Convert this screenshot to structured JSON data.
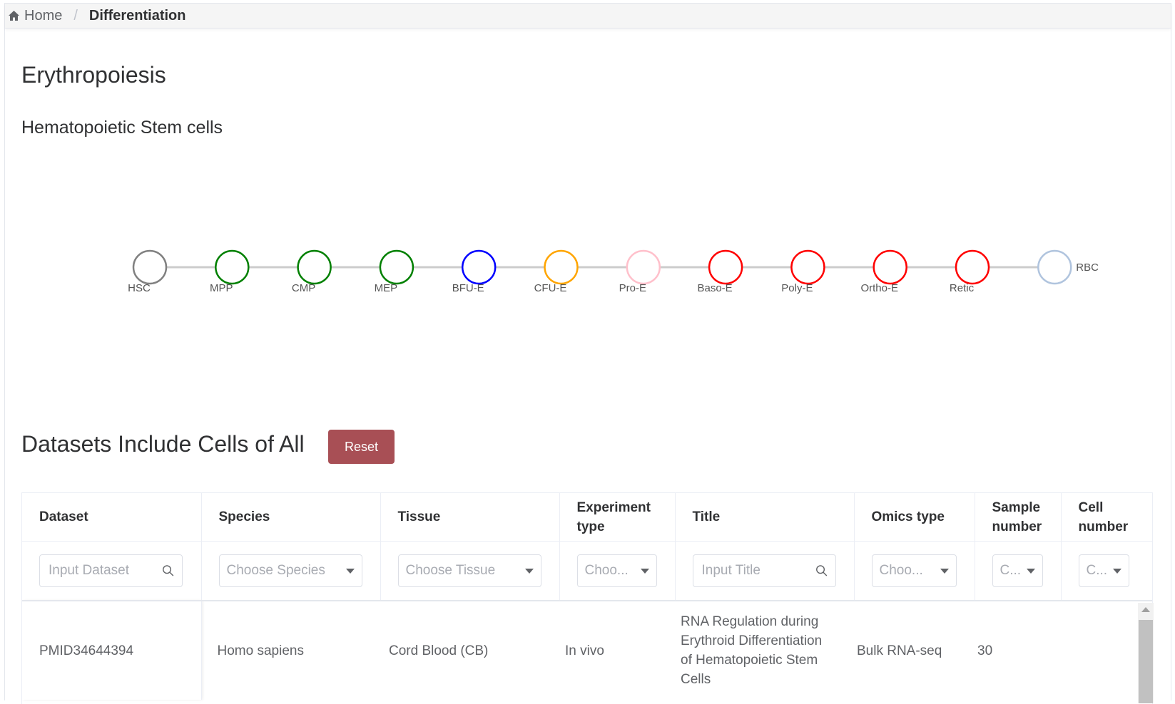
{
  "breadcrumb": {
    "home": "Home",
    "separator": "/",
    "current": "Differentiation"
  },
  "page_title": "Erythropoiesis",
  "sub_title": "Hematopoietic Stem cells",
  "lineage": {
    "line_color": "#cccccc",
    "nodes": [
      {
        "label": "HSC",
        "color": "#808080"
      },
      {
        "label": "MPP",
        "color": "#008000"
      },
      {
        "label": "CMP",
        "color": "#008000"
      },
      {
        "label": "MEP",
        "color": "#008000"
      },
      {
        "label": "BFU-E",
        "color": "#0000ff"
      },
      {
        "label": "CFU-E",
        "color": "#ffa500"
      },
      {
        "label": "Pro-E",
        "color": "#ffc0cb"
      },
      {
        "label": "Baso-E",
        "color": "#ff0000"
      },
      {
        "label": "Poly-E",
        "color": "#ff0000"
      },
      {
        "label": "Ortho-E",
        "color": "#ff0000"
      },
      {
        "label": "Retic",
        "color": "#ff0000"
      },
      {
        "label": "RBC",
        "color": "#b0c4de"
      }
    ]
  },
  "datasets": {
    "heading": "Datasets Include Cells of All",
    "reset_label": "Reset",
    "reset_color": "#a84f55"
  },
  "table": {
    "headers": {
      "dataset": "Dataset",
      "species": "Species",
      "tissue": "Tissue",
      "experiment_type": "Experiment type",
      "title": "Title",
      "omics_type": "Omics type",
      "sample_number": "Sample number",
      "cell_number": "Cell number"
    },
    "filters": {
      "dataset_placeholder": "Input Dataset",
      "species_placeholder": "Choose Species",
      "tissue_placeholder": "Choose Tissue",
      "experiment_placeholder": "Choo...",
      "title_placeholder": "Input Title",
      "omics_placeholder": "Choo...",
      "sample_placeholder": "C...",
      "cell_placeholder": "C..."
    },
    "rows": [
      {
        "dataset": "PMID34644394",
        "species": "Homo sapiens",
        "tissue": "Cord Blood (CB)",
        "experiment_type": "In vivo",
        "title": "RNA Regulation during Erythroid Differentiation of Hematopoietic Stem Cells",
        "omics_type": "Bulk RNA-seq",
        "sample_number": "30",
        "cell_number": ""
      }
    ]
  }
}
